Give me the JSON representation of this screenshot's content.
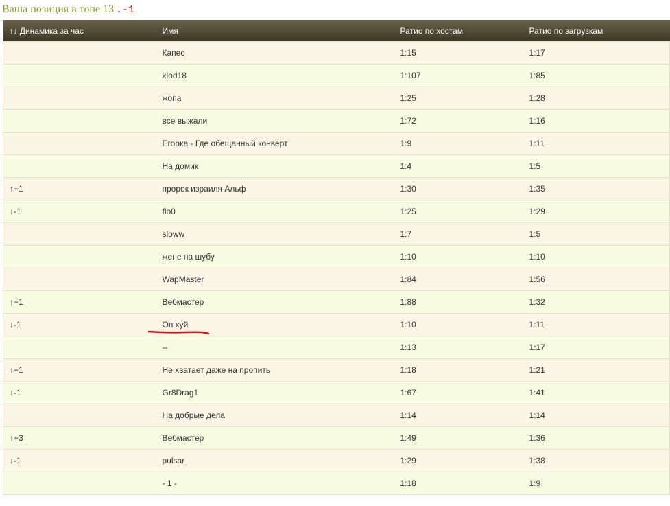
{
  "position": {
    "label": "Ваша позиция в топе 13",
    "delta": "↓-1"
  },
  "columns": {
    "dynamics": "↑↓ Динамика за час",
    "name": "Имя",
    "host_ratio": "Ратио по хостам",
    "load_ratio": "Ратио по загрузкам"
  },
  "rows": [
    {
      "dyn": "",
      "dir": "",
      "name": "Капес",
      "host": "1:15",
      "load": "1:17"
    },
    {
      "dyn": "",
      "dir": "",
      "name": "klod18",
      "host": "1:107",
      "load": "1:85"
    },
    {
      "dyn": "",
      "dir": "",
      "name": "жопа",
      "host": "1:25",
      "load": "1:28"
    },
    {
      "dyn": "",
      "dir": "",
      "name": "все выжали",
      "host": "1:72",
      "load": "1:16"
    },
    {
      "dyn": "",
      "dir": "",
      "name": "Егорка - Где обещанный конверт",
      "host": "1:9",
      "load": "1:11"
    },
    {
      "dyn": "",
      "dir": "",
      "name": "На домик",
      "host": "1:4",
      "load": "1:5"
    },
    {
      "dyn": "↑+1",
      "dir": "up",
      "name": "пророк израиля Альф",
      "host": "1:30",
      "load": "1:35"
    },
    {
      "dyn": "↓-1",
      "dir": "down",
      "name": "flo0",
      "host": "1:25",
      "load": "1:29"
    },
    {
      "dyn": "",
      "dir": "",
      "name": "sloww",
      "host": "1:7",
      "load": "1:5"
    },
    {
      "dyn": "",
      "dir": "",
      "name": "жене на шубу",
      "host": "1:10",
      "load": "1:10"
    },
    {
      "dyn": "",
      "dir": "",
      "name": "WapMaster",
      "host": "1:84",
      "load": "1:56"
    },
    {
      "dyn": "↑+1",
      "dir": "up",
      "name": "Вебмастер",
      "host": "1:88",
      "load": "1:32"
    },
    {
      "dyn": "↓-1",
      "dir": "down",
      "name": "Оп хуй",
      "host": "1:10",
      "load": "1:11",
      "highlighted": true
    },
    {
      "dyn": "",
      "dir": "",
      "name": "--",
      "host": "1:13",
      "load": "1:17"
    },
    {
      "dyn": "↑+1",
      "dir": "up",
      "name": "Не хватает даже на пропить",
      "host": "1:18",
      "load": "1:21"
    },
    {
      "dyn": "↓-1",
      "dir": "down",
      "name": "Gr8Drag1",
      "host": "1:67",
      "load": "1:41"
    },
    {
      "dyn": "",
      "dir": "",
      "name": "На добрые дела",
      "host": "1:14",
      "load": "1:14"
    },
    {
      "dyn": "↑+3",
      "dir": "up",
      "name": "Вебмастер",
      "host": "1:49",
      "load": "1:36"
    },
    {
      "dyn": "↓-1",
      "dir": "down",
      "name": "pulsar",
      "host": "1:29",
      "load": "1:38"
    },
    {
      "dyn": "",
      "dir": "",
      "name": "- 1 -",
      "host": "1:18",
      "load": "1:9"
    }
  ],
  "colors": {
    "position_text": "#8f9a2b",
    "delta_down": "#cc1111",
    "delta_up": "#2a8a2a",
    "header_bg": "#4f4734",
    "row_odd": "#fbf5e6",
    "row_even": "#f6fbe2",
    "marker_underline": "#e01010"
  }
}
